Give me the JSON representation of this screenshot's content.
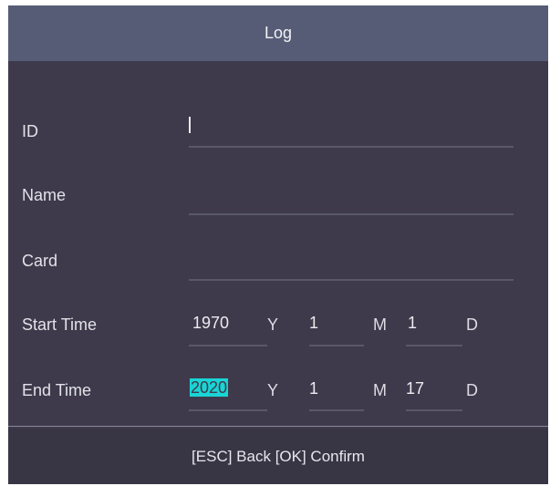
{
  "window": {
    "title": "Log"
  },
  "form": {
    "id_label": "ID",
    "name_label": "Name",
    "card_label": "Card",
    "start_time": {
      "label": "Start Time",
      "year": "1970",
      "year_unit": "Y",
      "month": "1",
      "month_unit": "M",
      "day": "1",
      "day_unit": "D"
    },
    "end_time": {
      "label": "End Time",
      "year": "2020",
      "year_unit": "Y",
      "month": "1",
      "month_unit": "M",
      "day": "17",
      "day_unit": "D"
    }
  },
  "footer": {
    "hint": "[ESC] Back [OK] Confirm"
  },
  "colors": {
    "background": "#3e3a4c",
    "title_bar": "#575c76",
    "selection": "#19d5d5"
  }
}
